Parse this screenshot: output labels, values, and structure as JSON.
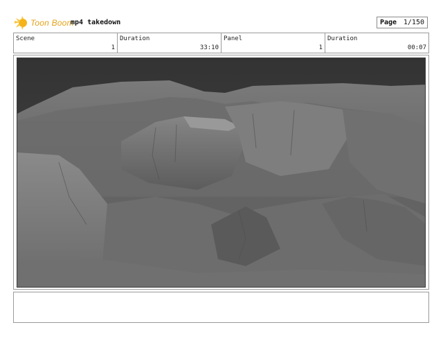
{
  "header": {
    "logo_text": "Toon Boom",
    "title": "mp4 takedown",
    "page_label": "Page",
    "page_value": "1/150"
  },
  "info": [
    {
      "label": "Scene",
      "value": "1"
    },
    {
      "label": "Duration",
      "value": "33:10"
    },
    {
      "label": "Panel",
      "value": "1"
    },
    {
      "label": "Duration",
      "value": "00:07"
    }
  ],
  "colors": {
    "logo_accent": "#e3a21a",
    "sky": "#3d3d3d",
    "terrain": "#6f6f6f"
  },
  "panel": {
    "image": "grayscale canyon terrain render"
  },
  "notes": {
    "text": ""
  }
}
